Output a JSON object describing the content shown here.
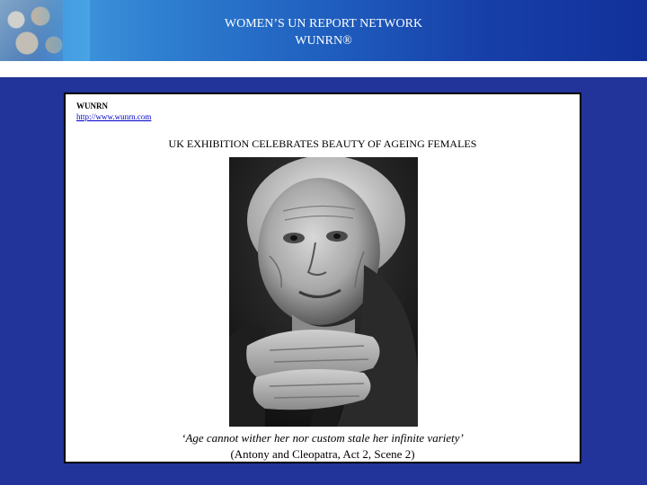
{
  "header": {
    "title_line1": "WOMEN’S UN REPORT NETWORK",
    "title_line2": "WUNRN®"
  },
  "panel": {
    "org_name": "WUNRN",
    "org_link": "http://www.wunrn.com",
    "headline": "UK EXHIBITION CELEBRATES BEAUTY OF AGEING FEMALES",
    "photo_caption_quote": "‘Age cannot wither her nor custom stale her infinite variety’",
    "photo_citation": "(Antony and Cleopatra, Act 2, Scene 2)"
  }
}
